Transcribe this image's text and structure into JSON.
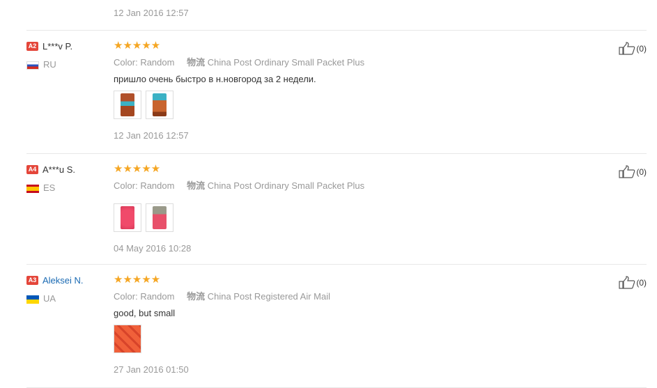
{
  "top": {
    "date": "12 Jan 2016 12:57"
  },
  "reviews": [
    {
      "level": "A2",
      "name": "L***v P.",
      "country": "RU",
      "stars": "★★★★★",
      "color_label": "Color:",
      "color_value": "Random",
      "shipping_label": "物流",
      "shipping_value": "China Post Ordinary Small Packet Plus",
      "comment": "пришло очень быстро в н.новгород за 2 недели.",
      "date": "12 Jan 2016 12:57",
      "likes": "(0)"
    },
    {
      "level": "A4",
      "name": "A***u S.",
      "country": "ES",
      "stars": "★★★★★",
      "color_label": "Color:",
      "color_value": "Random",
      "shipping_label": "物流",
      "shipping_value": "China Post Ordinary Small Packet Plus",
      "comment": "",
      "date": "04 May 2016 10:28",
      "likes": "(0)"
    },
    {
      "level": "A3",
      "name": "Aleksei N.",
      "country": "UA",
      "stars": "★★★★★",
      "color_label": "Color:",
      "color_value": "Random",
      "shipping_label": "物流",
      "shipping_value": "China Post Registered Air Mail",
      "comment": "good, but small",
      "date": "27 Jan 2016 01:50",
      "likes": "(0)"
    }
  ],
  "colors": {
    "star": "#f5a623",
    "level_badge": "#e4463a",
    "link": "#1a6ab3",
    "muted": "#999999"
  },
  "icons": {
    "like": "thumbs-up-icon"
  }
}
